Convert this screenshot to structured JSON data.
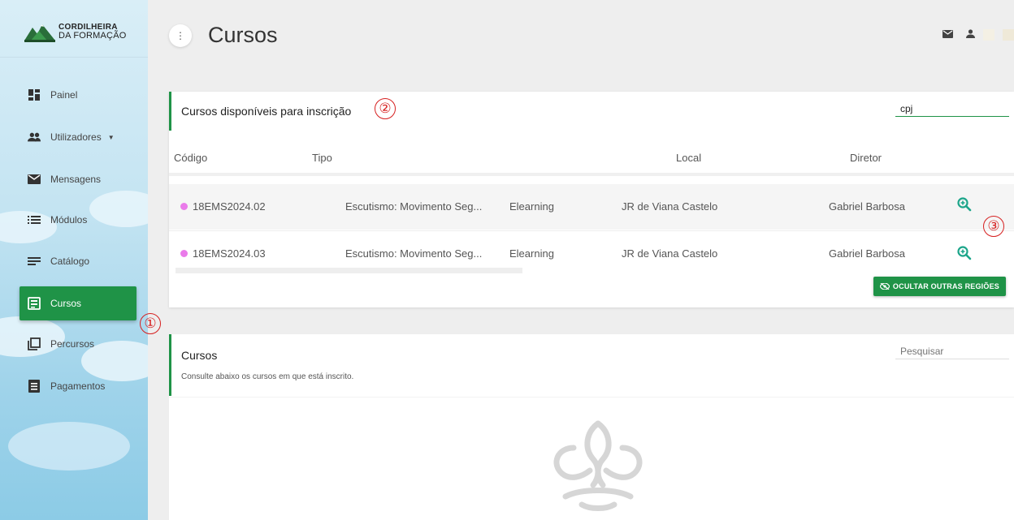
{
  "brand": {
    "line1": "CORDILHEIRA",
    "line2": "DA FORMAÇÃO"
  },
  "sidebar": {
    "items": [
      {
        "label": "Painel",
        "icon": "dashboard-icon"
      },
      {
        "label": "Utilizadores",
        "icon": "people-icon",
        "has_caret": true
      },
      {
        "label": "Mensagens",
        "icon": "mail-icon"
      },
      {
        "label": "Módulos",
        "icon": "list-icon"
      },
      {
        "label": "Catálogo",
        "icon": "catalog-icon"
      },
      {
        "label": "Cursos",
        "icon": "courses-icon",
        "active": true
      },
      {
        "label": "Percursos",
        "icon": "copy-icon"
      },
      {
        "label": "Pagamentos",
        "icon": "receipt-icon"
      }
    ]
  },
  "header": {
    "title": "Cursos",
    "menu_glyph": "⋮"
  },
  "markers": {
    "m1": "①",
    "m2": "②",
    "m3": "③"
  },
  "available": {
    "title": "Cursos disponíveis para inscrição",
    "search_value": "cpj",
    "columns": [
      "Código",
      "Tipo",
      "Local",
      "Diretor"
    ],
    "rows": [
      {
        "code": "18EMS2024.02",
        "name": "Escutismo: Movimento Seg...",
        "type": "Elearning",
        "local": "JR de Viana Castelo",
        "director": "Gabriel Barbosa"
      },
      {
        "code": "18EMS2024.03",
        "name": "Escutismo: Movimento Seg...",
        "type": "Elearning",
        "local": "JR de Viana Castelo",
        "director": "Gabriel Barbosa"
      }
    ],
    "hide_button": "OCULTAR OUTRAS REGIÕES"
  },
  "enrolled": {
    "title": "Cursos",
    "subtitle": "Consulte abaixo os cursos em que está inscrito.",
    "search_placeholder": "Pesquisar"
  },
  "colors": {
    "accent": "#1f9347",
    "marker": "#d62020",
    "status_dot": "#ea7bea",
    "zoom": "#1ca58a"
  }
}
